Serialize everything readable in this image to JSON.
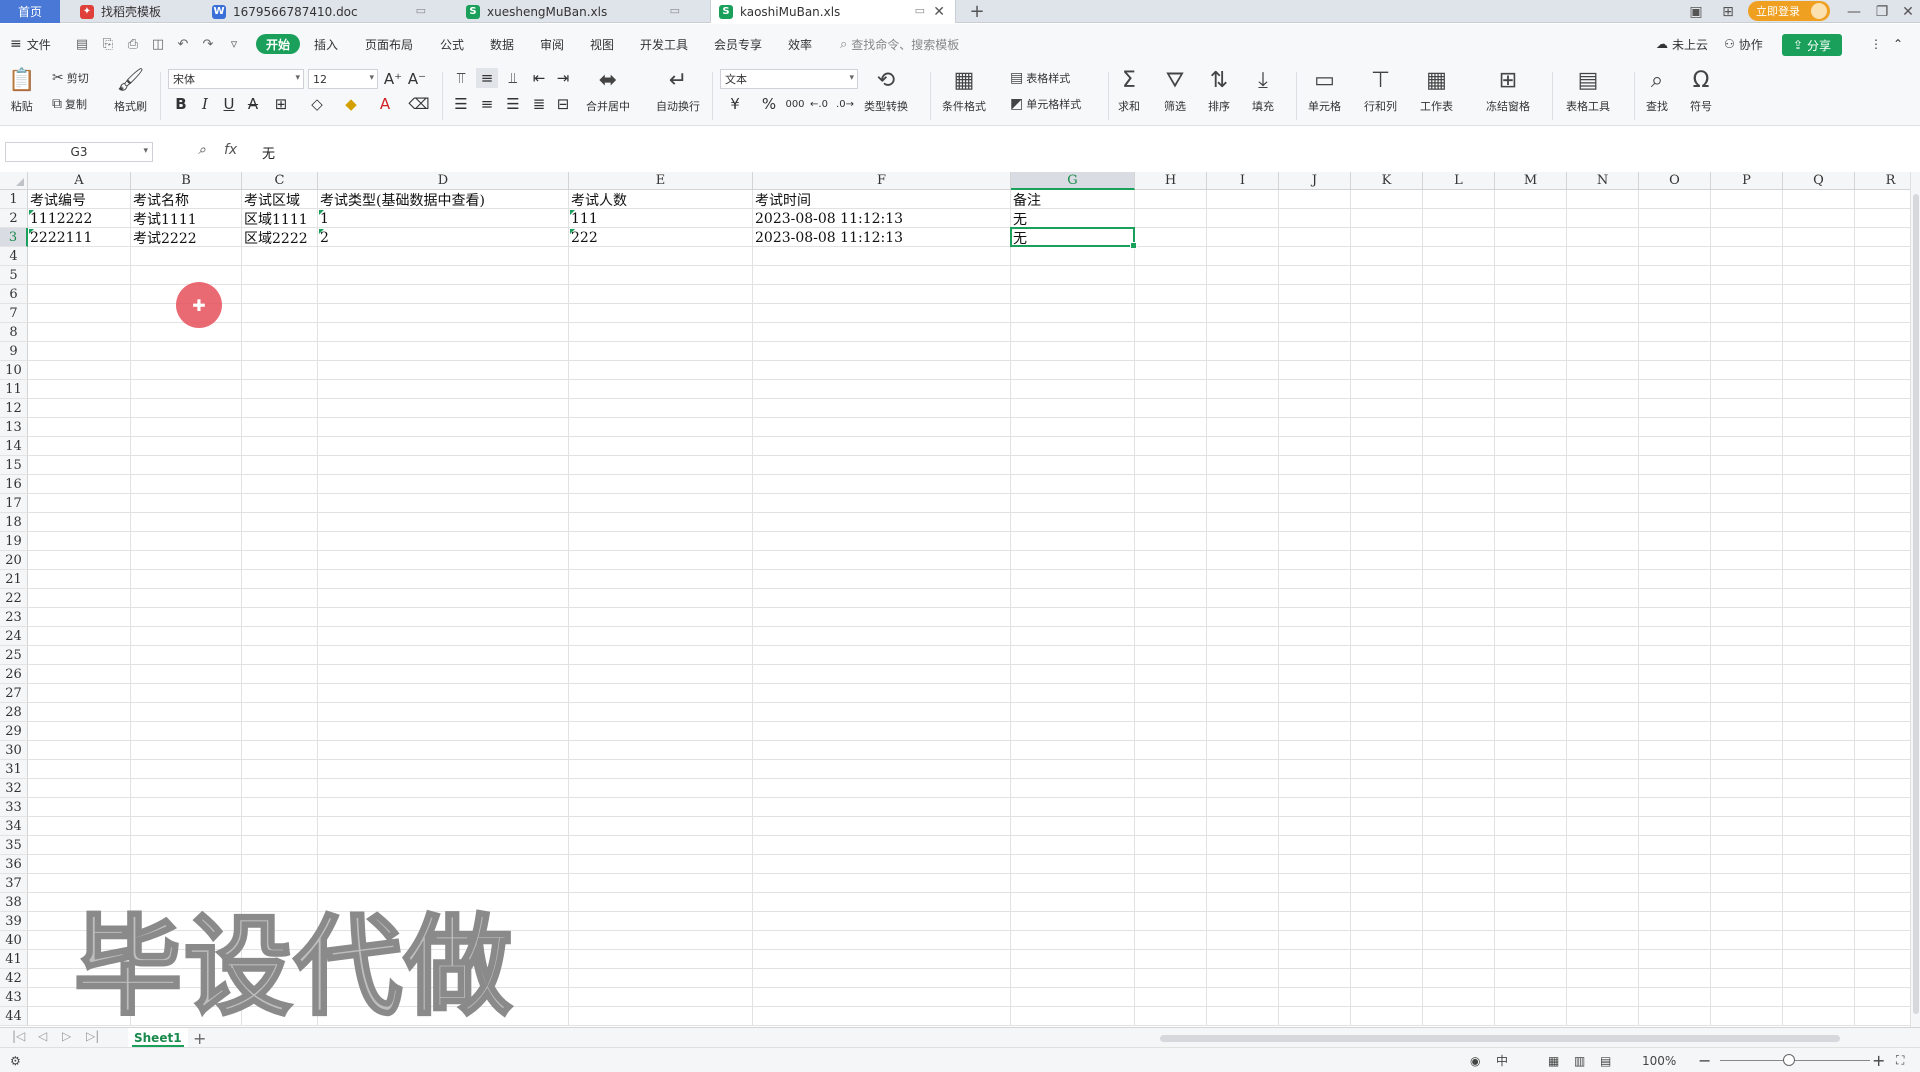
{
  "tabs": [
    {
      "label": "首页",
      "kind": "home"
    },
    {
      "label": "找稻壳模板",
      "kind": "docer",
      "color": "#e0403a"
    },
    {
      "label": "1679566787410.doc",
      "kind": "word",
      "color": "#3b6fd8"
    },
    {
      "label": "xueshengMuBan.xls",
      "kind": "sheet",
      "color": "#1aa05a"
    },
    {
      "label": "kaoshiMuBan.xls",
      "kind": "sheet",
      "color": "#1aa05a",
      "active": true
    }
  ],
  "login_label": "立即登录",
  "menu": {
    "file": "文件",
    "items": [
      "开始",
      "插入",
      "页面布局",
      "公式",
      "数据",
      "审阅",
      "视图",
      "开发工具",
      "会员专享",
      "效率"
    ],
    "search_placeholder": "查找命令、搜索模板",
    "cloud": "未上云",
    "collab": "协作",
    "share": "分享"
  },
  "ribbon": {
    "paste": "粘贴",
    "cut": "剪切",
    "copy": "复制",
    "format_painter": "格式刷",
    "font_name": "宋体",
    "font_size": "12",
    "number_format": "文本",
    "merge": "合并居中",
    "wrap": "自动换行",
    "type_convert": "类型转换",
    "cond_format": "条件格式",
    "table_style": "表格样式",
    "cell_style": "单元格样式",
    "sum": "求和",
    "filter": "筛选",
    "sort": "排序",
    "fill": "填充",
    "cell": "单元格",
    "rowcol": "行和列",
    "worksheet": "工作表",
    "freeze": "冻结窗格",
    "table_tools": "表格工具",
    "find": "查找",
    "symbol": "符号",
    "currency_symbol": "¥",
    "percent_symbol": "%",
    "thousands": "000"
  },
  "formula": {
    "name_box": "G3",
    "fx_label": "fx",
    "content": "无"
  },
  "sheet": {
    "columns": [
      "A",
      "B",
      "C",
      "D",
      "E",
      "F",
      "G",
      "H",
      "I",
      "J",
      "K",
      "L",
      "M",
      "N",
      "O",
      "P",
      "Q",
      "R"
    ],
    "selected_column": "G",
    "selected_row": 3,
    "row_count": 44,
    "rows": [
      [
        "考试编号",
        "考试名称",
        "考试区域",
        "考试类型(基础数据中查看)",
        "考试人数",
        "考试时间",
        "备注"
      ],
      [
        "1112222",
        "考试1111",
        "区域1111",
        "1",
        "111",
        "2023-08-08  11:12:13",
        "无"
      ],
      [
        "2222111",
        "考试2222",
        "区域2222",
        "2",
        "222",
        "2023-08-08  11:12:13",
        "无"
      ]
    ]
  },
  "watermark": "毕设代做",
  "sheet_tab": "Sheet1",
  "status": {
    "zoom": "100%",
    "input_mode": "中"
  }
}
